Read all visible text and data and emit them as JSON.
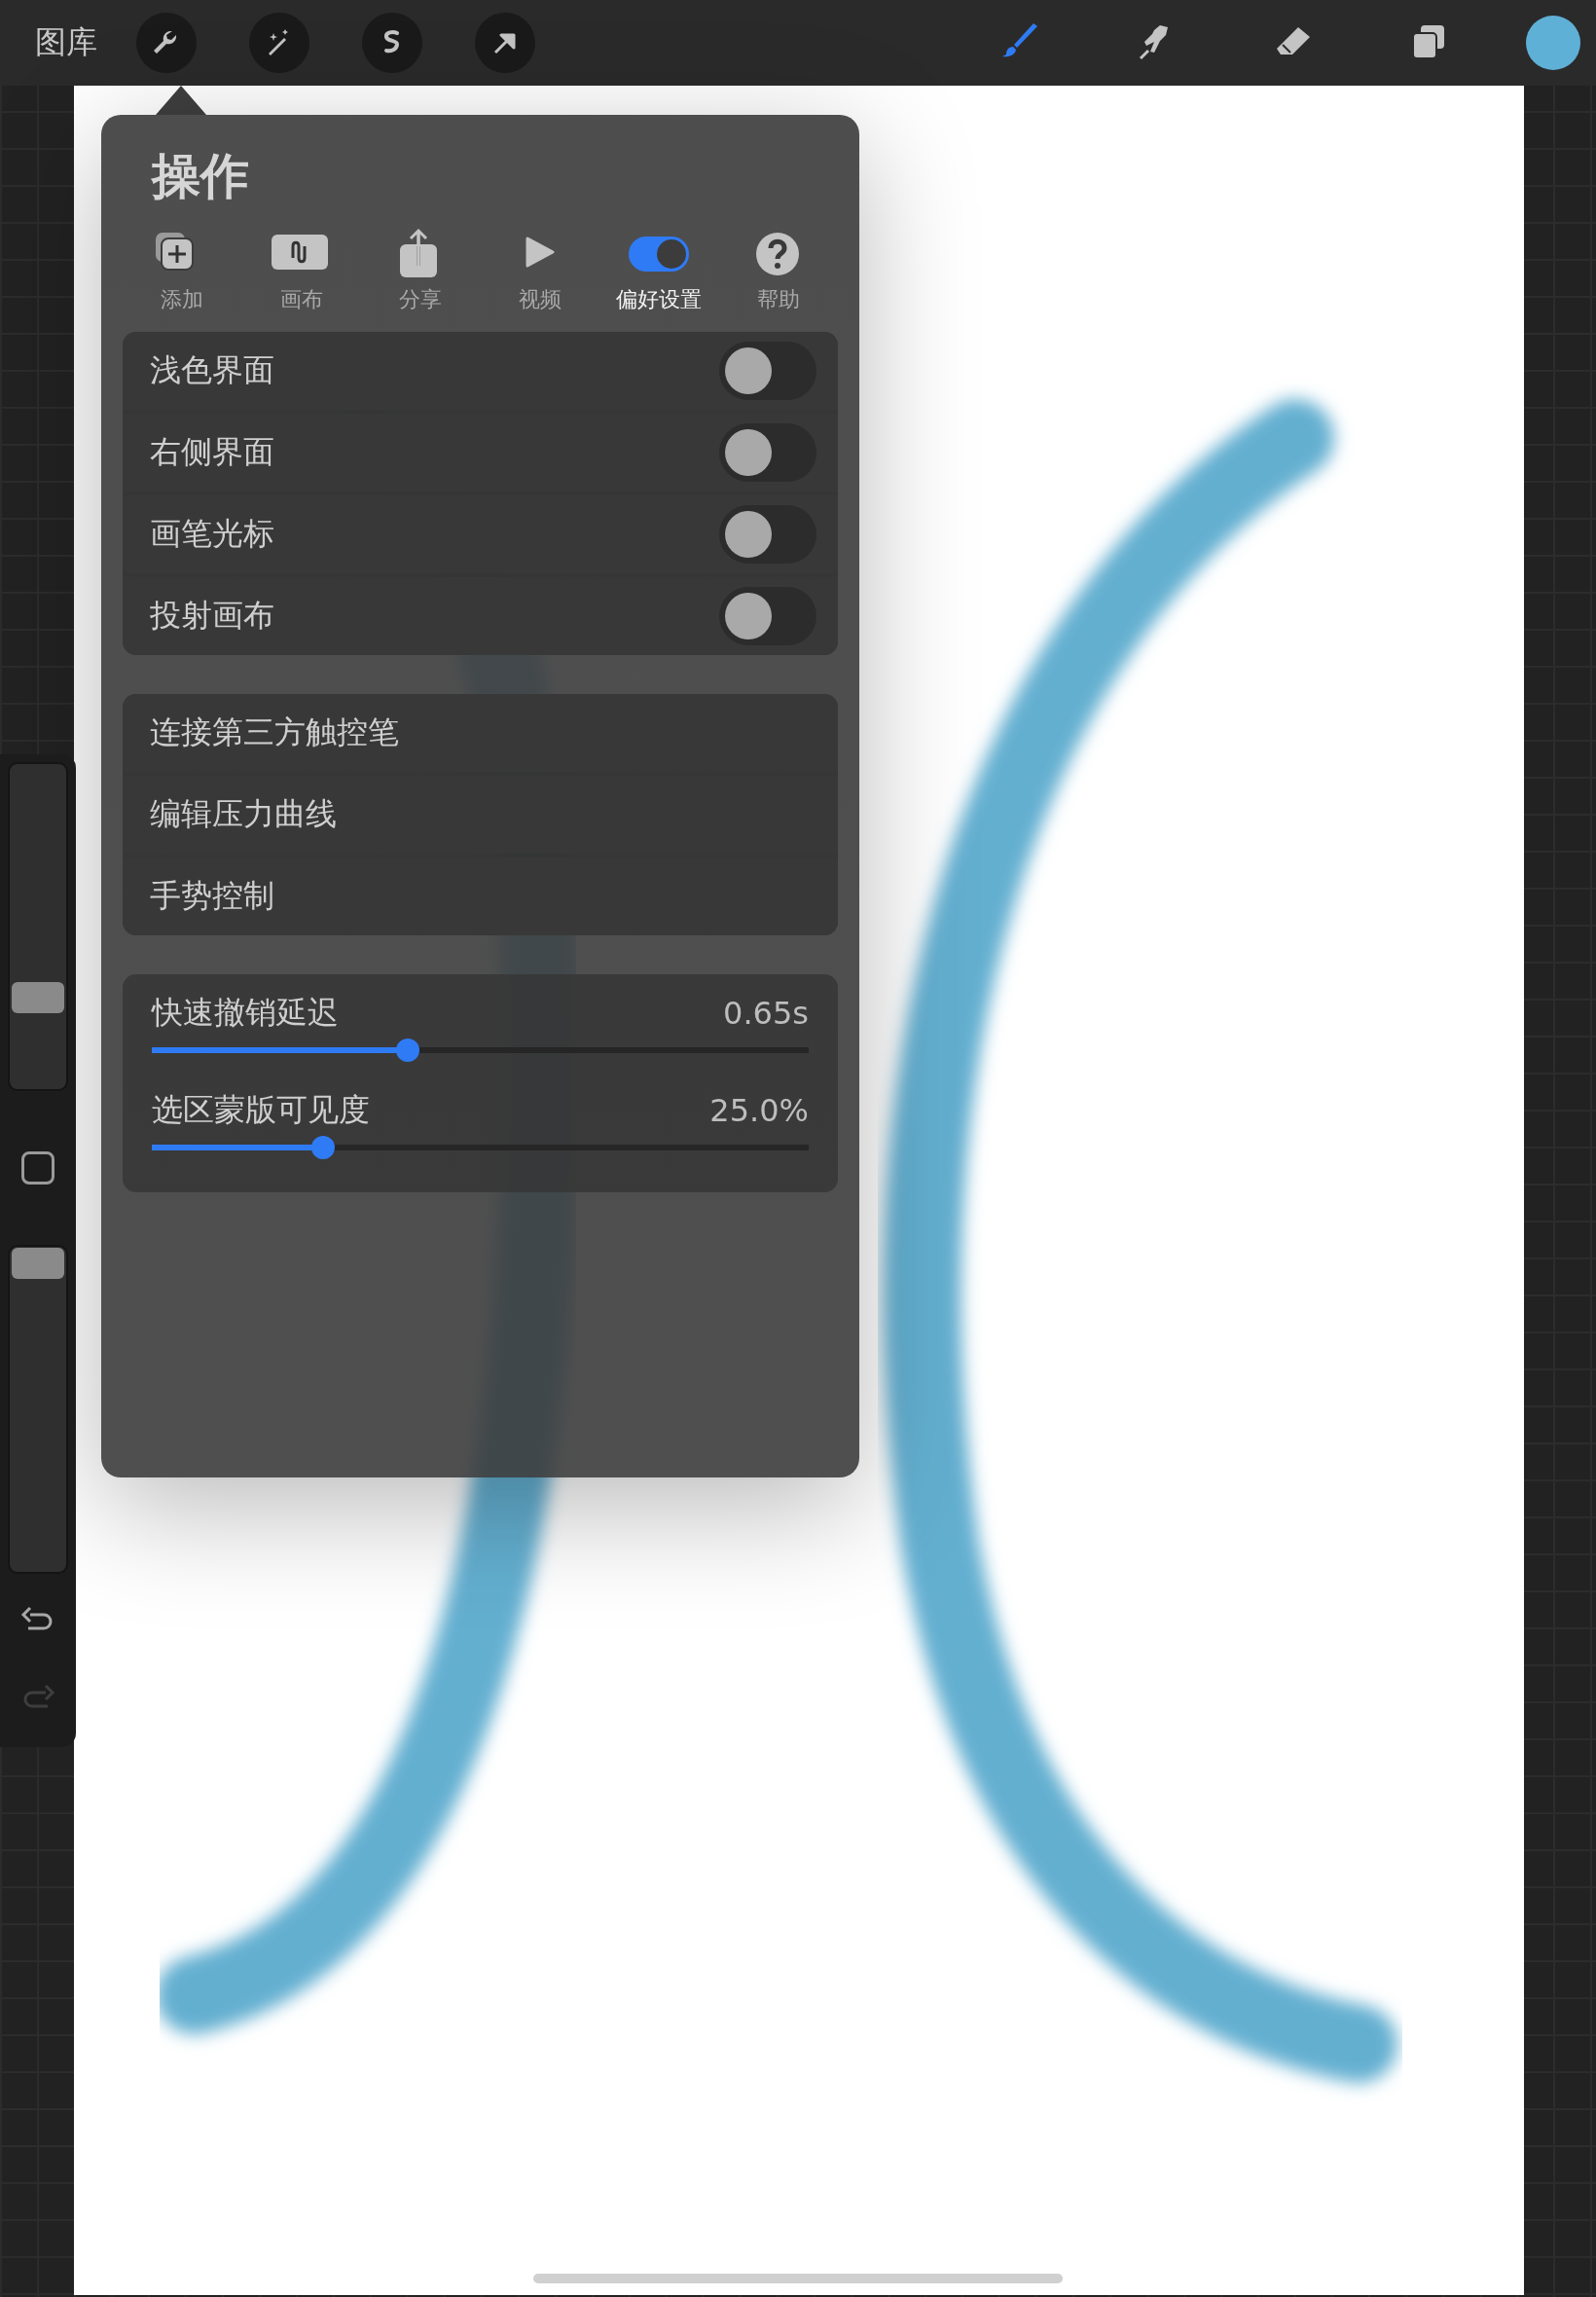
{
  "top_bar": {
    "gallery": "图库",
    "left_tools": [
      {
        "kind": "wrench"
      },
      {
        "kind": "wand"
      },
      {
        "kind": "selection"
      },
      {
        "kind": "transform"
      }
    ],
    "right_tools": [
      {
        "kind": "brush",
        "selected": true
      },
      {
        "kind": "smudge",
        "selected": false
      },
      {
        "kind": "eraser",
        "selected": false
      },
      {
        "kind": "layers",
        "selected": false
      }
    ],
    "color_swatch": {
      "color": "#5fb0d6"
    }
  },
  "sidebar": {
    "sliders": [
      {
        "level": 0.28
      },
      {
        "level": 0.95
      }
    ],
    "buttons": [
      {
        "kind": "undo",
        "disabled": false
      },
      {
        "kind": "redo",
        "disabled": true
      }
    ]
  },
  "panel": {
    "title": "操作",
    "tabs": [
      {
        "label": "添加",
        "kind": "add",
        "selected": false
      },
      {
        "label": "画布",
        "kind": "canvas",
        "selected": false
      },
      {
        "label": "分享",
        "kind": "share",
        "selected": false
      },
      {
        "label": "视频",
        "kind": "video",
        "selected": false
      },
      {
        "label": "偏好设置",
        "kind": "prefs",
        "selected": true
      },
      {
        "label": "帮助",
        "kind": "help",
        "selected": false
      }
    ],
    "toggles": [
      {
        "label": "浅色界面",
        "on": false
      },
      {
        "label": "右侧界面",
        "on": false
      },
      {
        "label": "画笔光标",
        "on": false
      },
      {
        "label": "投射画布",
        "on": false
      }
    ],
    "links": [
      "连接第三方触控笔",
      "编辑压力曲线",
      "手势控制"
    ],
    "sliders": [
      {
        "label": "快速撤销延迟",
        "reading": "0.65s",
        "level": 0.39
      },
      {
        "label": "选区蒙版可见度",
        "reading": "25.0%",
        "level": 0.26
      }
    ]
  }
}
